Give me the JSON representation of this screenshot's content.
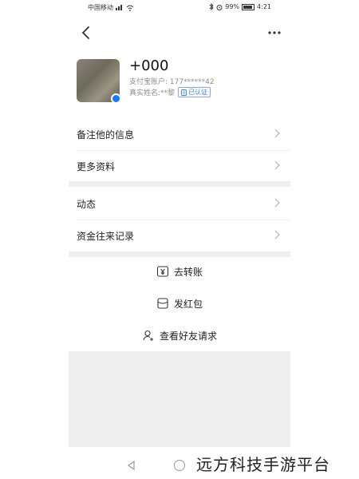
{
  "status_bar": {
    "carrier": "中国移动",
    "battery": "99%",
    "time": "4:21"
  },
  "profile": {
    "name": "+000",
    "account_label": "支付宝账户:",
    "account_value": "177******42",
    "realname_label": "真实姓名:",
    "realname_value": "**黎",
    "verified_badge": "已认证"
  },
  "menu": {
    "remark": "备注他的信息",
    "more_info": "更多资料",
    "moments": "动态",
    "transactions": "资金往来记录"
  },
  "actions": {
    "transfer": "去转账",
    "red_packet": "发红包",
    "friend_request": "查看好友请求"
  },
  "watermark": "远方科技手游平台",
  "colors": {
    "accent": "#1677ff",
    "separator": "#efefef"
  }
}
